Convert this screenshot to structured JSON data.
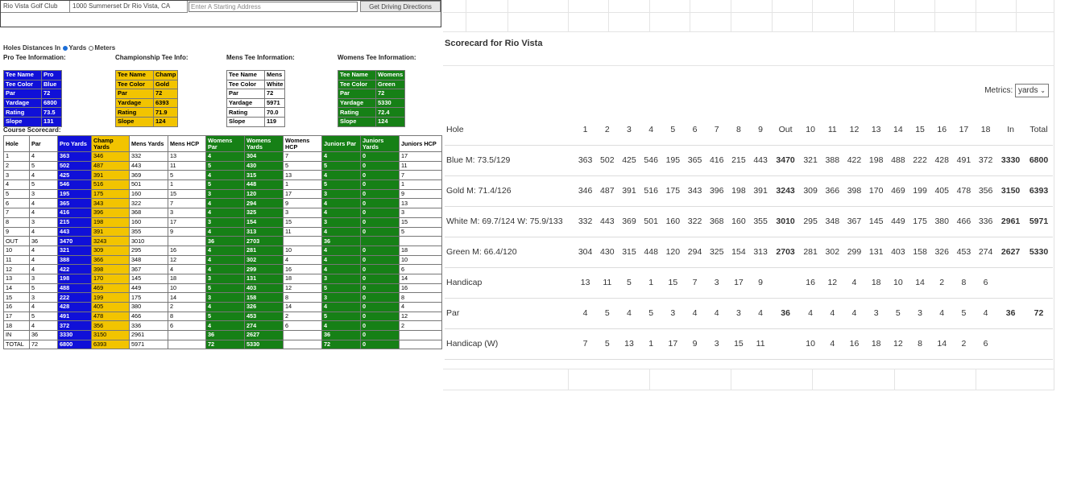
{
  "topbar": {
    "club_name": "Rio Vista Golf Club",
    "address": "1000 Summerset Dr Rio Vista, CA",
    "start_placeholder": "Enter A Starting Address",
    "directions_button": "Get Driving Directions"
  },
  "units": {
    "label": "Holes Distances In",
    "yards": "Yards",
    "meters": "Meters",
    "selected": "Yards"
  },
  "tee_headers": [
    "Pro Tee Information:",
    "Championship Tee Info:",
    "Mens Tee Information:",
    "Womens Tee Information:"
  ],
  "tee_tables": [
    {
      "rows": [
        [
          "Tee Name",
          "Pro"
        ],
        [
          "Tee Color",
          "Blue"
        ],
        [
          "Par",
          "72"
        ],
        [
          "Yardage",
          "6800"
        ],
        [
          "Rating",
          "73.5"
        ],
        [
          "Slope",
          "131"
        ]
      ]
    },
    {
      "rows": [
        [
          "Tee Name",
          "Champ"
        ],
        [
          "Tee Color",
          "Gold"
        ],
        [
          "Par",
          "72"
        ],
        [
          "Yardage",
          "6393"
        ],
        [
          "Rating",
          "71.9"
        ],
        [
          "Slope",
          "124"
        ]
      ]
    },
    {
      "rows": [
        [
          "Tee Name",
          "Mens"
        ],
        [
          "Tee Color",
          "White"
        ],
        [
          "Par",
          "72"
        ],
        [
          "Yardage",
          "5971"
        ],
        [
          "Rating",
          "70.0"
        ],
        [
          "Slope",
          "119"
        ]
      ]
    },
    {
      "rows": [
        [
          "Tee Name",
          "Womens"
        ],
        [
          "Tee Color",
          "Green"
        ],
        [
          "Par",
          "72"
        ],
        [
          "Yardage",
          "5330"
        ],
        [
          "Rating",
          "72.4"
        ],
        [
          "Slope",
          "124"
        ]
      ]
    }
  ],
  "course_scorecard_title": "Course Scorecard:",
  "scorecard": {
    "headers": [
      "Hole",
      "Par",
      "Pro Yards",
      "Champ Yards",
      "Mens Yards",
      "Mens HCP",
      "Womens Par",
      "Womens Yards",
      "Womens HCP",
      "Juniors Par",
      "Juniors Yards",
      "Juniors HCP"
    ],
    "rows": [
      [
        "1",
        "4",
        "363",
        "346",
        "332",
        "13",
        "4",
        "304",
        "7",
        "4",
        "0",
        "17"
      ],
      [
        "2",
        "5",
        "502",
        "487",
        "443",
        "11",
        "5",
        "430",
        "5",
        "5",
        "0",
        "11"
      ],
      [
        "3",
        "4",
        "425",
        "391",
        "369",
        "5",
        "4",
        "315",
        "13",
        "4",
        "0",
        "7"
      ],
      [
        "4",
        "5",
        "546",
        "516",
        "501",
        "1",
        "5",
        "448",
        "1",
        "5",
        "0",
        "1"
      ],
      [
        "5",
        "3",
        "195",
        "175",
        "160",
        "15",
        "3",
        "120",
        "17",
        "3",
        "0",
        "9"
      ],
      [
        "6",
        "4",
        "365",
        "343",
        "322",
        "7",
        "4",
        "294",
        "9",
        "4",
        "0",
        "13"
      ],
      [
        "7",
        "4",
        "416",
        "396",
        "368",
        "3",
        "4",
        "325",
        "3",
        "4",
        "0",
        "3"
      ],
      [
        "8",
        "3",
        "215",
        "198",
        "160",
        "17",
        "3",
        "154",
        "15",
        "3",
        "0",
        "15"
      ],
      [
        "9",
        "4",
        "443",
        "391",
        "355",
        "9",
        "4",
        "313",
        "11",
        "4",
        "0",
        "5"
      ],
      [
        "OUT",
        "36",
        "3470",
        "3243",
        "3010",
        "",
        "36",
        "2703",
        "",
        "36",
        "",
        ""
      ],
      [
        "10",
        "4",
        "321",
        "309",
        "295",
        "16",
        "4",
        "281",
        "10",
        "4",
        "0",
        "18"
      ],
      [
        "11",
        "4",
        "388",
        "366",
        "348",
        "12",
        "4",
        "302",
        "4",
        "4",
        "0",
        "10"
      ],
      [
        "12",
        "4",
        "422",
        "398",
        "367",
        "4",
        "4",
        "299",
        "16",
        "4",
        "0",
        "6"
      ],
      [
        "13",
        "3",
        "198",
        "170",
        "145",
        "18",
        "3",
        "131",
        "18",
        "3",
        "0",
        "14"
      ],
      [
        "14",
        "5",
        "488",
        "469",
        "449",
        "10",
        "5",
        "403",
        "12",
        "5",
        "0",
        "16"
      ],
      [
        "15",
        "3",
        "222",
        "199",
        "175",
        "14",
        "3",
        "158",
        "8",
        "3",
        "0",
        "8"
      ],
      [
        "16",
        "4",
        "428",
        "405",
        "380",
        "2",
        "4",
        "326",
        "14",
        "4",
        "0",
        "4"
      ],
      [
        "17",
        "5",
        "491",
        "478",
        "466",
        "8",
        "5",
        "453",
        "2",
        "5",
        "0",
        "12"
      ],
      [
        "18",
        "4",
        "372",
        "356",
        "336",
        "6",
        "4",
        "274",
        "6",
        "4",
        "0",
        "2"
      ],
      [
        "IN",
        "36",
        "3330",
        "3150",
        "2961",
        "",
        "36",
        "2627",
        "",
        "36",
        "0",
        ""
      ],
      [
        "TOTAL",
        "72",
        "6800",
        "6393",
        "5971",
        "",
        "72",
        "5330",
        "",
        "72",
        "0",
        ""
      ]
    ]
  },
  "right": {
    "title": "Scorecard for Rio Vista",
    "metrics_label": "Metrics:",
    "metrics_value": "yards",
    "header": [
      "Hole",
      "1",
      "2",
      "3",
      "4",
      "5",
      "6",
      "7",
      "8",
      "9",
      "Out",
      "10",
      "11",
      "12",
      "13",
      "14",
      "15",
      "16",
      "17",
      "18",
      "In",
      "Total"
    ],
    "rows": [
      [
        "Blue M: 73.5/129",
        "363",
        "502",
        "425",
        "546",
        "195",
        "365",
        "416",
        "215",
        "443",
        "3470",
        "321",
        "388",
        "422",
        "198",
        "488",
        "222",
        "428",
        "491",
        "372",
        "3330",
        "6800"
      ],
      [
        "Gold M: 71.4/126",
        "346",
        "487",
        "391",
        "516",
        "175",
        "343",
        "396",
        "198",
        "391",
        "3243",
        "309",
        "366",
        "398",
        "170",
        "469",
        "199",
        "405",
        "478",
        "356",
        "3150",
        "6393"
      ],
      [
        "White M: 69.7/124 W: 75.9/133",
        "332",
        "443",
        "369",
        "501",
        "160",
        "322",
        "368",
        "160",
        "355",
        "3010",
        "295",
        "348",
        "367",
        "145",
        "449",
        "175",
        "380",
        "466",
        "336",
        "2961",
        "5971"
      ],
      [
        "Green M: 66.4/120",
        "304",
        "430",
        "315",
        "448",
        "120",
        "294",
        "325",
        "154",
        "313",
        "2703",
        "281",
        "302",
        "299",
        "131",
        "403",
        "158",
        "326",
        "453",
        "274",
        "2627",
        "5330"
      ],
      [
        "Handicap",
        "13",
        "11",
        "5",
        "1",
        "15",
        "7",
        "3",
        "17",
        "9",
        "",
        "16",
        "12",
        "4",
        "18",
        "10",
        "14",
        "2",
        "8",
        "6",
        "",
        ""
      ],
      [
        "Par",
        "4",
        "5",
        "4",
        "5",
        "3",
        "4",
        "4",
        "3",
        "4",
        "36",
        "4",
        "4",
        "4",
        "3",
        "5",
        "3",
        "4",
        "5",
        "4",
        "36",
        "72"
      ],
      [
        "Handicap (W)",
        "7",
        "5",
        "13",
        "1",
        "17",
        "9",
        "3",
        "15",
        "11",
        "",
        "10",
        "4",
        "16",
        "18",
        "12",
        "8",
        "14",
        "2",
        "6",
        "",
        ""
      ]
    ]
  },
  "colors": {
    "pro": "#1010d8",
    "champ": "#f2c400",
    "mens": "#ffffff",
    "womens": "#168016"
  }
}
